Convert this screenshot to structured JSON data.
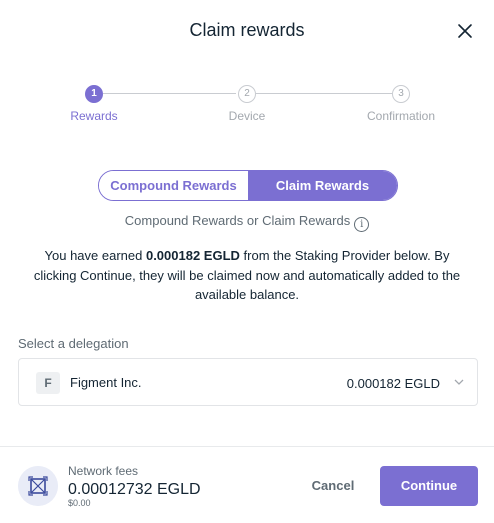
{
  "modal": {
    "title": "Claim rewards"
  },
  "steps": [
    {
      "number": "1",
      "label": "Rewards",
      "state": "active"
    },
    {
      "number": "2",
      "label": "Device",
      "state": "todo"
    },
    {
      "number": "3",
      "label": "Confirmation",
      "state": "todo"
    }
  ],
  "toggle": {
    "compound_label": "Compound Rewards",
    "claim_label": "Claim Rewards",
    "selected": "Claim Rewards"
  },
  "subtitle": {
    "text": "Compound Rewards or Claim Rewards",
    "info_icon_glyph": "i"
  },
  "description": {
    "before": "You have earned ",
    "amount": "0.000182 EGLD",
    "after": " from the Staking Provider below. By clicking Continue, they will be claimed now and automatically added to the available balance."
  },
  "delegation": {
    "section_label": "Select a delegation",
    "avatar_letter": "F",
    "name": "Figment Inc.",
    "amount": "0.000182 EGLD"
  },
  "footer": {
    "fees_label": "Network fees",
    "fees_amount": "0.00012732 EGLD",
    "fees_fiat": "$0.00",
    "cancel_label": "Cancel",
    "continue_label": "Continue"
  },
  "colors": {
    "accent": "#7b6fd2",
    "text": "#142533",
    "muted": "#5f6b74"
  }
}
